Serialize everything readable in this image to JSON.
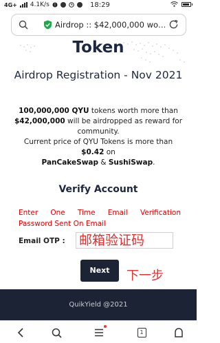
{
  "status_bar": {
    "network": "4G+",
    "speed": "4.1K/s",
    "time": "18:29",
    "battery_level": 0.85,
    "icons": [
      "signal-bars-icon",
      "notification-icon",
      "weibo-icon",
      "clock-icon",
      "app-icon",
      "wifi-icon",
      "battery-icon"
    ]
  },
  "browser": {
    "url_text": "Airdrop :: $42,000,000 wo…",
    "icons": [
      "search-icon",
      "shield-check-icon",
      "reload-icon"
    ]
  },
  "page": {
    "heading": "Token",
    "subheading": "Airdrop Registration - Nov 2021",
    "desc_amount": "100,000,000 QYU",
    "desc_text1": " tokens worth more than ",
    "desc_value": "$42,000,000",
    "desc_text2": " will be airdropped as reward for community.",
    "desc_price_intro": "Current price of QYU Tokens is more than ",
    "desc_price": "$0.42",
    "desc_on": " on",
    "exchange_1": "PanCakeSwap",
    "amp": " & ",
    "exchange_2": "SushiSwap",
    "period": ".",
    "verify_title": "Verify Account",
    "notice_words": [
      "Enter",
      "One",
      "Time",
      "Email",
      "Verification"
    ],
    "notice_line2": "Password Sent On Email",
    "otp_label": "Email OTP :",
    "otp_value": "邮箱验证码",
    "next_label": "Next",
    "annotation": "下一步",
    "footer": "QuikYield @2021"
  },
  "navbar": {
    "tab_count": "1",
    "icons": [
      "back-icon",
      "search-icon",
      "menu-icon",
      "tabs-icon",
      "home-icon"
    ]
  },
  "colors": {
    "navy": "#1b2335",
    "title": "#1d2740",
    "red": "#e00000",
    "secure_green": "#1ea84a"
  }
}
